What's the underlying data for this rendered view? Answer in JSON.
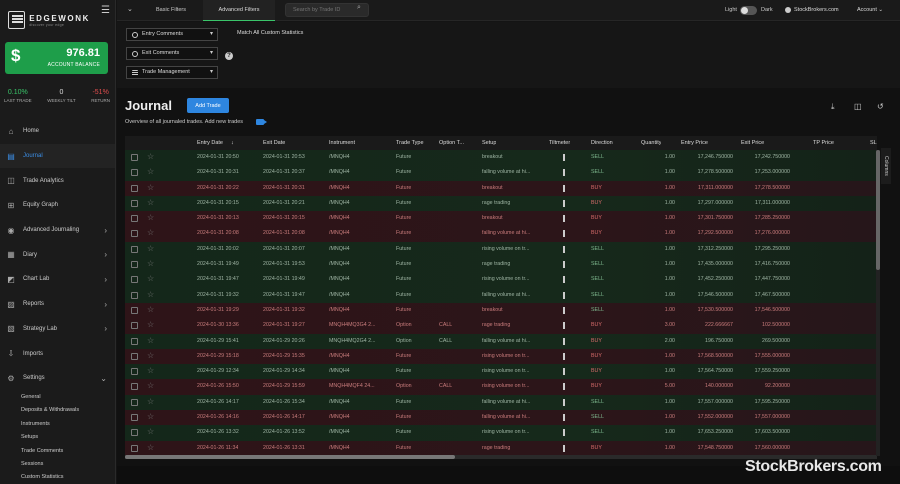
{
  "brand": {
    "name": "EDGEWONK",
    "tagline": "discover your edge"
  },
  "account": {
    "currency_symbol": "$",
    "balance": "976.81",
    "balance_label": "ACCOUNT BALANCE"
  },
  "stats": [
    {
      "value": "0.10%",
      "label": "LAST TRADE",
      "tone": "green"
    },
    {
      "value": "0",
      "label": "WEEKLY TILT",
      "tone": "white"
    },
    {
      "value": "-51%",
      "label": "RETURN",
      "tone": "red"
    }
  ],
  "nav": [
    {
      "label": "Home",
      "icon": "home-icon",
      "glyph": "⌂",
      "chevron": false,
      "active": false
    },
    {
      "label": "Journal",
      "icon": "journal-icon",
      "glyph": "▤",
      "chevron": false,
      "active": true
    },
    {
      "label": "Trade Analytics",
      "icon": "analytics-icon",
      "glyph": "◫",
      "chevron": false,
      "active": false
    },
    {
      "label": "Equity Graph",
      "icon": "equity-graph-icon",
      "glyph": "⊞",
      "chevron": false,
      "active": false
    },
    {
      "label": "Advanced Journaling",
      "icon": "location-icon",
      "glyph": "◉",
      "chevron": true,
      "active": false
    },
    {
      "label": "Diary",
      "icon": "diary-icon",
      "glyph": "▦",
      "chevron": true,
      "active": false
    },
    {
      "label": "Chart Lab",
      "icon": "chart-icon",
      "glyph": "◩",
      "chevron": true,
      "active": false
    },
    {
      "label": "Reports",
      "icon": "reports-icon",
      "glyph": "▨",
      "chevron": true,
      "active": false
    },
    {
      "label": "Strategy Lab",
      "icon": "strategy-icon",
      "glyph": "▧",
      "chevron": true,
      "active": false
    },
    {
      "label": "Imports",
      "icon": "imports-icon",
      "glyph": "⇩",
      "chevron": false,
      "active": false
    },
    {
      "label": "Settings",
      "icon": "gear-icon",
      "glyph": "⚙",
      "chevron": true,
      "expanded": true,
      "active": false
    }
  ],
  "settings_submenu": [
    "General",
    "Deposits & Withdrawals",
    "Instruments",
    "Setups",
    "Trade Comments",
    "Sessions",
    "Custom Statistics"
  ],
  "topbar": {
    "tabs": [
      "Basic Filters",
      "Advanced Filters"
    ],
    "search_placeholder": "Search by Trade ID",
    "theme_light": "Light",
    "theme_dark": "Dark",
    "broker": "StockBrokers.com",
    "account_menu": "Account"
  },
  "filters": {
    "dropdowns": [
      "Entry Comments",
      "Exit Comments",
      "Trade Management"
    ],
    "match_label": "Match All Custom Statistics"
  },
  "journal": {
    "title": "Journal",
    "add_button": "Add Trade",
    "subtitle": "Overview of all journaled trades. Add new trades",
    "columns_tab": "Columns"
  },
  "table": {
    "headers": [
      "Entry Date",
      "Exit Date",
      "Instrument",
      "Trade Type",
      "Option T...",
      "Setup",
      "Tiltmeter",
      "Direction",
      "Quantity",
      "Entry Price",
      "Exit Price",
      "TP Price",
      "SL"
    ],
    "sort_indicator": "↓",
    "rows": [
      {
        "tone": "green",
        "entry": "2024-01-31 20:50",
        "exit": "2024-01-31 20:53",
        "instrument": "/MNQH4",
        "type": "Future",
        "option": "",
        "setup": "breakout",
        "direction": "SELL",
        "qty": "1.00",
        "entry_price": "17,246.750000",
        "exit_price": "17,242.750000"
      },
      {
        "tone": "green",
        "entry": "2024-01-31 20:31",
        "exit": "2024-01-31 20:37",
        "instrument": "/MNQH4",
        "type": "Future",
        "option": "",
        "setup": "falling volume at hi...",
        "direction": "SELL",
        "qty": "1.00",
        "entry_price": "17,278.500000",
        "exit_price": "17,253.000000"
      },
      {
        "tone": "red",
        "entry": "2024-01-31 20:22",
        "exit": "2024-01-31 20:31",
        "instrument": "/MNQH4",
        "type": "Future",
        "option": "",
        "setup": "breakout",
        "direction": "BUY",
        "qty": "1.00",
        "entry_price": "17,311.000000",
        "exit_price": "17,278.500000"
      },
      {
        "tone": "green",
        "entry": "2024-01-31 20:15",
        "exit": "2024-01-31 20:21",
        "instrument": "/MNQH4",
        "type": "Future",
        "option": "",
        "setup": "rage trading",
        "direction": "BUY",
        "qty": "1.00",
        "entry_price": "17,297.000000",
        "exit_price": "17,311.000000"
      },
      {
        "tone": "red",
        "entry": "2024-01-31 20:13",
        "exit": "2024-01-31 20:15",
        "instrument": "/MNQH4",
        "type": "Future",
        "option": "",
        "setup": "breakout",
        "direction": "BUY",
        "qty": "1.00",
        "entry_price": "17,301.750000",
        "exit_price": "17,285.250000"
      },
      {
        "tone": "red",
        "entry": "2024-01-31 20:08",
        "exit": "2024-01-31 20:08",
        "instrument": "/MNQH4",
        "type": "Future",
        "option": "",
        "setup": "falling volume at hi...",
        "direction": "BUY",
        "qty": "1.00",
        "entry_price": "17,292.500000",
        "exit_price": "17,276.000000"
      },
      {
        "tone": "green",
        "entry": "2024-01-31 20:02",
        "exit": "2024-01-31 20:07",
        "instrument": "/MNQH4",
        "type": "Future",
        "option": "",
        "setup": "rising volume on tr...",
        "direction": "SELL",
        "qty": "1.00",
        "entry_price": "17,312.250000",
        "exit_price": "17,295.250000"
      },
      {
        "tone": "green",
        "entry": "2024-01-31 19:49",
        "exit": "2024-01-31 19:53",
        "instrument": "/MNQH4",
        "type": "Future",
        "option": "",
        "setup": "rage trading",
        "direction": "SELL",
        "qty": "1.00",
        "entry_price": "17,435.000000",
        "exit_price": "17,416.750000"
      },
      {
        "tone": "green",
        "entry": "2024-01-31 19:47",
        "exit": "2024-01-31 19:49",
        "instrument": "/MNQH4",
        "type": "Future",
        "option": "",
        "setup": "rising volume on tr...",
        "direction": "SELL",
        "qty": "1.00",
        "entry_price": "17,452.250000",
        "exit_price": "17,447.750000"
      },
      {
        "tone": "green",
        "entry": "2024-01-31 19:32",
        "exit": "2024-01-31 19:47",
        "instrument": "/MNQH4",
        "type": "Future",
        "option": "",
        "setup": "falling volume at hi...",
        "direction": "SELL",
        "qty": "1.00",
        "entry_price": "17,546.500000",
        "exit_price": "17,467.500000"
      },
      {
        "tone": "red",
        "entry": "2024-01-31 19:29",
        "exit": "2024-01-31 19:32",
        "instrument": "/MNQH4",
        "type": "Future",
        "option": "",
        "setup": "breakout",
        "direction": "SELL",
        "qty": "1.00",
        "entry_price": "17,530.500000",
        "exit_price": "17,546.500000"
      },
      {
        "tone": "red",
        "entry": "2024-01-30 13:36",
        "exit": "2024-01-31 19:27",
        "instrument": "MNQH4MQ3G4 2...",
        "type": "Option",
        "option": "CALL",
        "setup": "rage trading",
        "direction": "BUY",
        "qty": "3.00",
        "entry_price": "222.666667",
        "exit_price": "102.500000"
      },
      {
        "tone": "green",
        "entry": "2024-01-29 15:41",
        "exit": "2024-01-29 20:26",
        "instrument": "MNQH4MQ2G4 2...",
        "type": "Option",
        "option": "CALL",
        "setup": "falling volume at hi...",
        "direction": "BUY",
        "qty": "2.00",
        "entry_price": "196.750000",
        "exit_price": "269.500000"
      },
      {
        "tone": "red",
        "entry": "2024-01-29 15:18",
        "exit": "2024-01-29 15:35",
        "instrument": "/MNQH4",
        "type": "Future",
        "option": "",
        "setup": "rising volume on tr...",
        "direction": "BUY",
        "qty": "1.00",
        "entry_price": "17,568.500000",
        "exit_price": "17,555.000000"
      },
      {
        "tone": "green",
        "entry": "2024-01-29 12:34",
        "exit": "2024-01-29 14:34",
        "instrument": "/MNQH4",
        "type": "Future",
        "option": "",
        "setup": "rising volume on tr...",
        "direction": "BUY",
        "qty": "1.00",
        "entry_price": "17,564.750000",
        "exit_price": "17,559.250000"
      },
      {
        "tone": "red",
        "entry": "2024-01-26 15:50",
        "exit": "2024-01-29 15:59",
        "instrument": "MNQH4MQF4 24...",
        "type": "Option",
        "option": "CALL",
        "setup": "rising volume on tr...",
        "direction": "BUY",
        "qty": "5.00",
        "entry_price": "140.000000",
        "exit_price": "92.200000"
      },
      {
        "tone": "green",
        "entry": "2024-01-26 14:17",
        "exit": "2024-01-26 15:34",
        "instrument": "/MNQH4",
        "type": "Future",
        "option": "",
        "setup": "falling volume at hi...",
        "direction": "SELL",
        "qty": "1.00",
        "entry_price": "17,557.000000",
        "exit_price": "17,595.250000"
      },
      {
        "tone": "red",
        "entry": "2024-01-26 14:16",
        "exit": "2024-01-26 14:17",
        "instrument": "/MNQH4",
        "type": "Future",
        "option": "",
        "setup": "falling volume at hi...",
        "direction": "SELL",
        "qty": "1.00",
        "entry_price": "17,552.000000",
        "exit_price": "17,557.000000"
      },
      {
        "tone": "green",
        "entry": "2024-01-26 13:32",
        "exit": "2024-01-26 13:52",
        "instrument": "/MNQH4",
        "type": "Future",
        "option": "",
        "setup": "rising volume on tr...",
        "direction": "SELL",
        "qty": "1.00",
        "entry_price": "17,653.250000",
        "exit_price": "17,603.500000"
      },
      {
        "tone": "red",
        "entry": "2024-01-26 11:34",
        "exit": "2024-01-26 13:31",
        "instrument": "/MNQH4",
        "type": "Future",
        "option": "",
        "setup": "rage trading",
        "direction": "BUY",
        "qty": "1.00",
        "entry_price": "17,548.750000",
        "exit_price": "17,560.000000"
      }
    ]
  },
  "watermark": "StockBrokers.com",
  "colors": {
    "accent": "#2e86e0",
    "balance": "#1e9e4a",
    "win_row": "#16291b",
    "loss_row": "#2c1519"
  }
}
